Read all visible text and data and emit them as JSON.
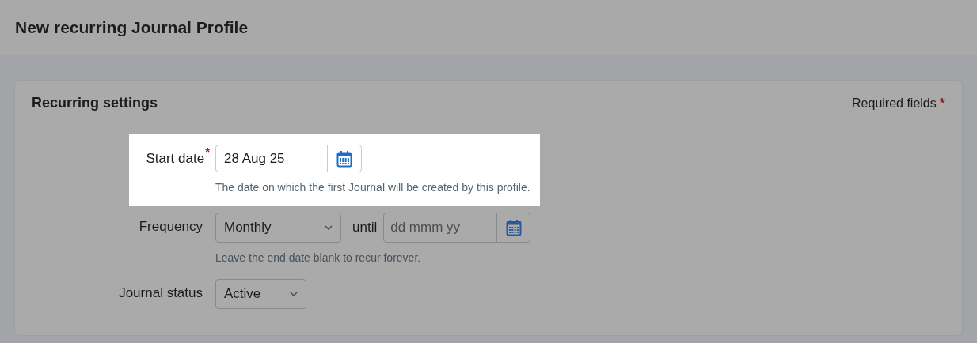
{
  "page": {
    "title": "New recurring Journal Profile"
  },
  "card": {
    "title": "Recurring settings",
    "required_note": "Required fields",
    "required_mark": "*"
  },
  "fields": [
    {
      "kind": "date",
      "label": "Start date",
      "required": true,
      "value": "28 Aug 25",
      "help": "The date on which the first Journal will be created by this profile.",
      "highlighted": true
    },
    {
      "kind": "select_until",
      "label": "Frequency",
      "required": false,
      "value": "Monthly",
      "until_label": "until",
      "until_placeholder": "dd mmm yy",
      "help": "Leave the end date blank to recur forever.",
      "highlighted": false
    },
    {
      "kind": "select",
      "label": "Journal status",
      "required": false,
      "value": "Active",
      "highlighted": false
    }
  ]
}
